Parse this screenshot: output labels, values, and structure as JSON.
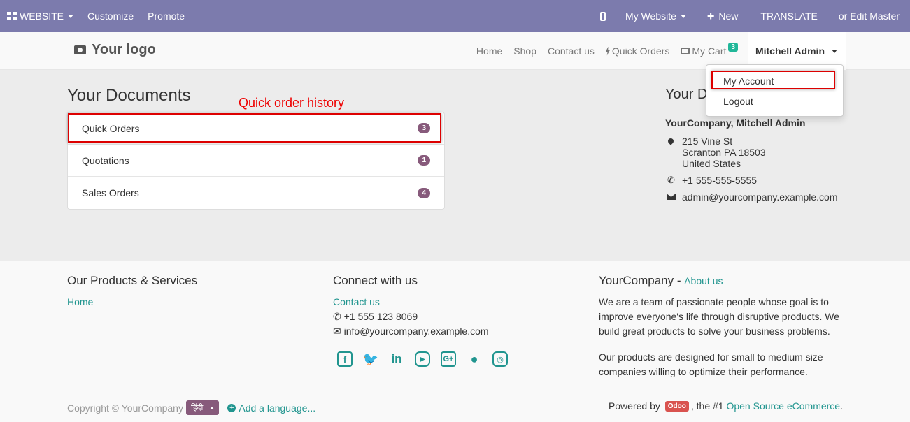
{
  "admin_bar": {
    "website": "WEBSITE",
    "customize": "Customize",
    "promote": "Promote",
    "my_website": "My Website",
    "new": "New",
    "translate": "TRANSLATE",
    "edit_master": "or Edit Master"
  },
  "header": {
    "logo": "Your logo",
    "nav": [
      "Home",
      "Shop",
      "Contact us",
      "Quick Orders",
      "My Cart"
    ],
    "cart_count": "3",
    "user": "Mitchell Admin"
  },
  "dropdown": {
    "items": [
      "My Account",
      "Logout"
    ]
  },
  "documents": {
    "title": "Your Documents",
    "annotation": "Quick order history",
    "items": [
      {
        "label": "Quick Orders",
        "count": "3"
      },
      {
        "label": "Quotations",
        "count": "1"
      },
      {
        "label": "Sales Orders",
        "count": "4"
      }
    ]
  },
  "details": {
    "title": "Your D",
    "company": "YourCompany, Mitchell Admin",
    "address": [
      "215 Vine St",
      "Scranton PA 18503",
      "United States"
    ],
    "phone": "+1 555-555-5555",
    "email": "admin@yourcompany.example.com"
  },
  "footer": {
    "products_title": "Our Products & Services",
    "products_links": [
      "Home"
    ],
    "connect_title": "Connect with us",
    "connect_link": "Contact us",
    "connect_phone": "+1 555 123 8069",
    "connect_email": "info@yourcompany.example.com",
    "social_icons": [
      "facebook-icon",
      "twitter-icon",
      "linkedin-icon",
      "youtube-icon",
      "google-plus-icon",
      "github-icon",
      "instagram-icon"
    ],
    "about_company": "YourCompany",
    "about_sep": " - ",
    "about_link": "About us",
    "about_p1": "We are a team of passionate people whose goal is to improve everyone's life through disruptive products. We build great products to solve your business problems.",
    "about_p2": "Our products are designed for small to medium size companies willing to optimize their performance.",
    "copyright": "Copyright © YourCompany",
    "language": "हिंदी",
    "add_language": "Add a language...",
    "powered_by": "Powered by",
    "odoo": "Odoo",
    "the_1": ", the #1",
    "open_source": "Open Source eCommerce",
    "period": "."
  },
  "colors": {
    "admin_bar": "#7c7bad",
    "accent": "#21958f",
    "badge": "#875a7b",
    "highlight": "#dd0000"
  }
}
